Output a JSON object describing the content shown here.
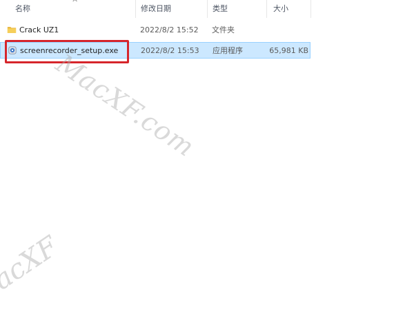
{
  "columns": {
    "name": "名称",
    "date": "修改日期",
    "type": "类型",
    "size": "大小",
    "sort_indicator": "^"
  },
  "files": [
    {
      "name": "Crack UZ1",
      "date": "2022/8/2 15:52",
      "type": "文件夹",
      "size": "",
      "icon": "folder-icon",
      "selected": false
    },
    {
      "name": "screenrecorder_setup.exe",
      "date": "2022/8/2 15:53",
      "type": "应用程序",
      "size": "65,981 KB",
      "icon": "installer-icon",
      "selected": true
    }
  ],
  "watermark": {
    "main": "MacXF.com",
    "corner": "acXF"
  },
  "colors": {
    "selection_bg": "#cce8ff",
    "selection_border": "#99d1ff",
    "highlight_box": "#d6252b",
    "folder": "#f4c542"
  }
}
